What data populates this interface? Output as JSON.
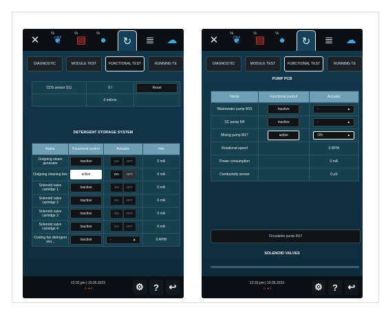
{
  "colors": {
    "accent": "#6f9fb5",
    "panel": "#12364a",
    "bar": "#0b0f13",
    "alert": "#e23b2e"
  },
  "toolbar_icons": [
    "wrench-screwdriver-icon",
    "tap-water-icon",
    "detergent-icon",
    "water-drop-icon",
    "cleaning-cycle-icon",
    "list-icon",
    "dishes-icon"
  ],
  "left": {
    "tabs": [
      "DIAGNOSTIC",
      "MODULE TEST",
      "FUNCTIONAL TEST",
      "RUNNING TE"
    ],
    "sensor": {
      "name": "CDS sensor S11",
      "value": "0 l",
      "reset": "Reset",
      "rate": "0 ml/min"
    },
    "section_title": "DETERGENT STORAGE SYSTEM",
    "table": {
      "headers": [
        "Name",
        "Functional control",
        "Actuator",
        "Info"
      ],
      "rows": [
        {
          "name": "Outgoing steam generator",
          "control": "inactive",
          "on": "ON",
          "off": "OFF",
          "info": "0 mA"
        },
        {
          "name": "Outgoing cleaning box",
          "control": "active",
          "on": "ON",
          "off": "OFF",
          "info": "0 mA"
        },
        {
          "name": "Solenoid valve cartridge 1",
          "control": "inactive",
          "on": "ON",
          "off": "OFF",
          "info": "0 mA"
        },
        {
          "name": "Solenoid valve cartridge 2",
          "control": "inactive",
          "on": "ON",
          "off": "OFF",
          "info": "0 mA"
        },
        {
          "name": "Solenoid valve cartridge 3",
          "control": "inactive",
          "on": "ON",
          "off": "OFF",
          "info": "0 mA"
        },
        {
          "name": "Solenoid valve cartridge 4",
          "control": "inactive",
          "on": "ON",
          "off": "OFF",
          "info": "0 mA"
        },
        {
          "name": "Cooling fan detergent stor...",
          "control": "inactive",
          "dropdown": "-",
          "info": "0 RPM"
        }
      ]
    },
    "bottom": {
      "time": "12:32 pm | 10.05.2023"
    }
  },
  "right": {
    "tabs": [
      "DIAGNOSTIC",
      "MODULE TEST",
      "FUNCTIONAL TEST",
      "RUNNING TE"
    ],
    "section_title": "PUMP PCB",
    "table": {
      "headers": [
        "Name",
        "Functional control",
        "Actuator"
      ],
      "rows": [
        {
          "name": "Wastewater pump M15",
          "control": "inactive",
          "actuator": "-"
        },
        {
          "name": "SC pump M4",
          "control": "inactive",
          "actuator": "-"
        },
        {
          "name": "Mixing pump M17",
          "control": "active",
          "actuator": "ON"
        }
      ],
      "readings": [
        {
          "name": "Rotational speed",
          "value": "0 RPM"
        },
        {
          "name": "Power consumption",
          "value": "0 mA"
        },
        {
          "name": "Conductivity sensor",
          "value": "0 µS"
        }
      ]
    },
    "circulation_button": "Circulation pump M17",
    "section2_title": "SOLENOID VALVES",
    "bottom": {
      "time": "12:33 pm | 10.05.2023"
    }
  }
}
